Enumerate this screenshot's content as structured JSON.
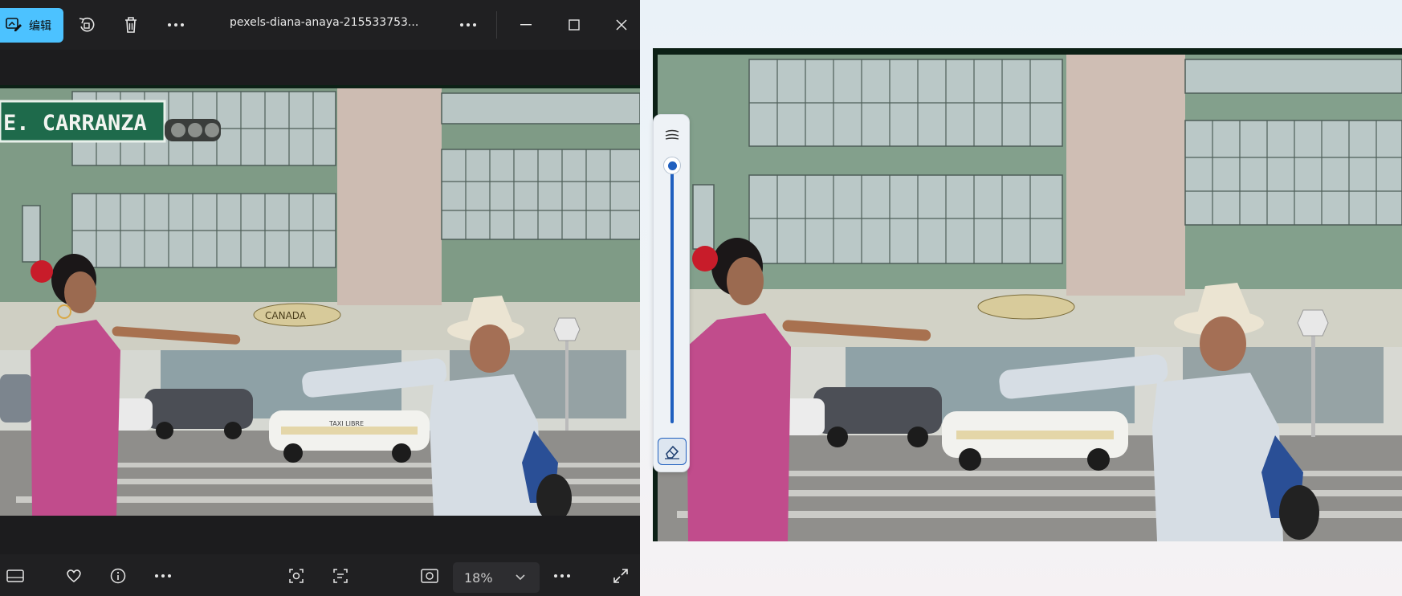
{
  "viewer": {
    "edit_label": "编辑",
    "file_title": "pexels-diana-anaya-215533753...",
    "zoom_value": "18%"
  },
  "photo": {
    "street_sign": "E. CARRANZA",
    "store_sign": "CANADA",
    "taxi_text": "TAXI LIBRE"
  },
  "colors": {
    "accent": "#4cc2ff",
    "slider_blue": "#1f5fbf",
    "toolbar_bg": "#202022"
  },
  "compare": {
    "slider_level": 0.0
  }
}
